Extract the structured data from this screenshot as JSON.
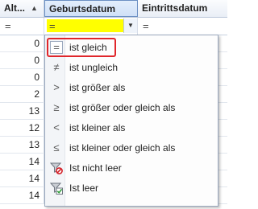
{
  "header": {
    "col_alter": "Alt...",
    "col_geburtsdatum": "Geburtsdatum",
    "col_eintrittsdatum": "Eintrittsdatum"
  },
  "filter_row": {
    "alter_symbol": "=",
    "geburtsdatum_symbol": "=",
    "eintrittsdatum_symbol": "="
  },
  "rows": [
    "0",
    "0",
    "0",
    "2",
    "13",
    "12",
    "13",
    "14",
    "14",
    "14"
  ],
  "menu": {
    "items": [
      {
        "icon": "equals-icon",
        "glyph": "=",
        "label": "ist gleich"
      },
      {
        "icon": "not-equals-icon",
        "glyph": "≠",
        "label": "ist ungleich"
      },
      {
        "icon": "greater-than-icon",
        "glyph": ">",
        "label": "ist größer als"
      },
      {
        "icon": "greater-equal-icon",
        "glyph": "≥",
        "label": "ist größer oder gleich als"
      },
      {
        "icon": "less-than-icon",
        "glyph": "<",
        "label": "ist kleiner als"
      },
      {
        "icon": "less-equal-icon",
        "glyph": "≤",
        "label": "ist kleiner oder gleich als"
      },
      {
        "icon": "not-empty-filter-icon",
        "glyph": "",
        "label": "Ist nicht leer"
      },
      {
        "icon": "empty-filter-icon",
        "glyph": "",
        "label": "Ist leer"
      }
    ]
  },
  "colors": {
    "selection_outline": "#e0262b",
    "filter_highlight": "#ffff00"
  }
}
